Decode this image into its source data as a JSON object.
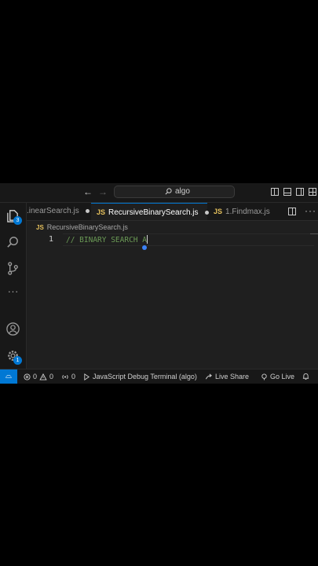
{
  "titlebar": {
    "command_center": "algo"
  },
  "activity": {
    "explorer_badge": "3",
    "settings_badge": "1"
  },
  "tabs": [
    {
      "label": ".inearSearch.js",
      "modified": true
    },
    {
      "icon_label": "JS",
      "label": "RecursiveBinarySearch.js",
      "modified": true,
      "active": true
    },
    {
      "icon_label": "JS",
      "label": "1.Findmax.js"
    }
  ],
  "breadcrumb": {
    "icon_label": "JS",
    "file": "RecursiveBinarySearch.js"
  },
  "editor": {
    "line_number": "1",
    "code": "// BINARY SEARCH A"
  },
  "statusbar": {
    "errors": "0",
    "warnings": "0",
    "ports": "0",
    "debug_terminal": "JavaScript Debug Terminal (algo)",
    "live_share": "Live Share",
    "go_live": "Go Live"
  },
  "colors": {
    "accent": "#0078d4",
    "comment": "#6a9955",
    "js": "#e5c05c"
  }
}
